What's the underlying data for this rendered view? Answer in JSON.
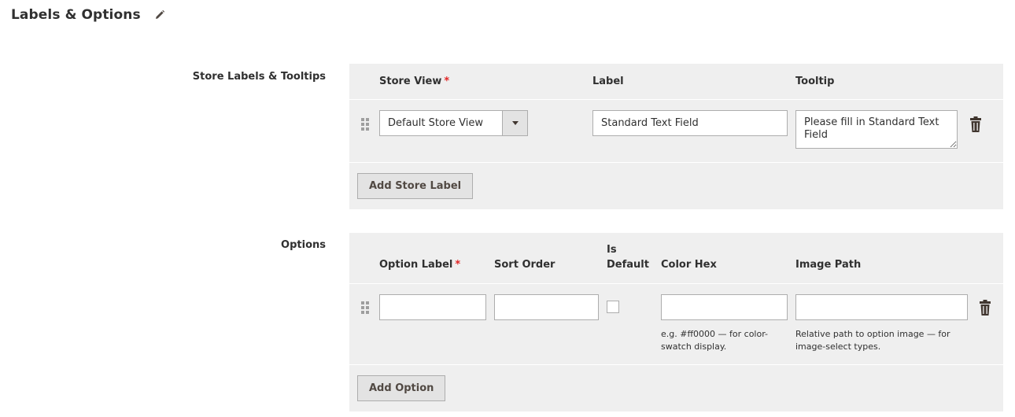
{
  "section": {
    "title": "Labels & Options",
    "edit_icon": "pencil-icon"
  },
  "store_labels": {
    "field_label": "Store Labels & Tooltips",
    "columns": {
      "store_view": "Store View",
      "required_mark": "*",
      "label": "Label",
      "tooltip": "Tooltip"
    },
    "rows": [
      {
        "store_view": "Default Store View",
        "label": "Standard Text Field",
        "tooltip": "Please fill in Standard Text Field"
      }
    ],
    "add_button": "Add Store Label"
  },
  "options": {
    "field_label": "Options",
    "columns": {
      "option_label": "Option Label",
      "required_mark": "*",
      "sort_order": "Sort Order",
      "is_default_line1": "Is",
      "is_default_line2": "Default",
      "color_hex": "Color Hex",
      "image_path": "Image Path"
    },
    "rows": [
      {
        "option_label": "",
        "sort_order": "",
        "is_default": false,
        "color_hex": "",
        "image_path": ""
      }
    ],
    "notes": {
      "color_hex": "e.g. #ff0000 — for color-swatch display.",
      "image_path": "Relative path to option image — for image-select types."
    },
    "add_button": "Add Option"
  },
  "icons": {
    "drag": "drag-handle-icon",
    "delete": "trash-icon"
  },
  "colors": {
    "panel_bg": "#efefef",
    "required": "#e22626",
    "button_bg": "#e3e3e3",
    "text": "#303030"
  }
}
